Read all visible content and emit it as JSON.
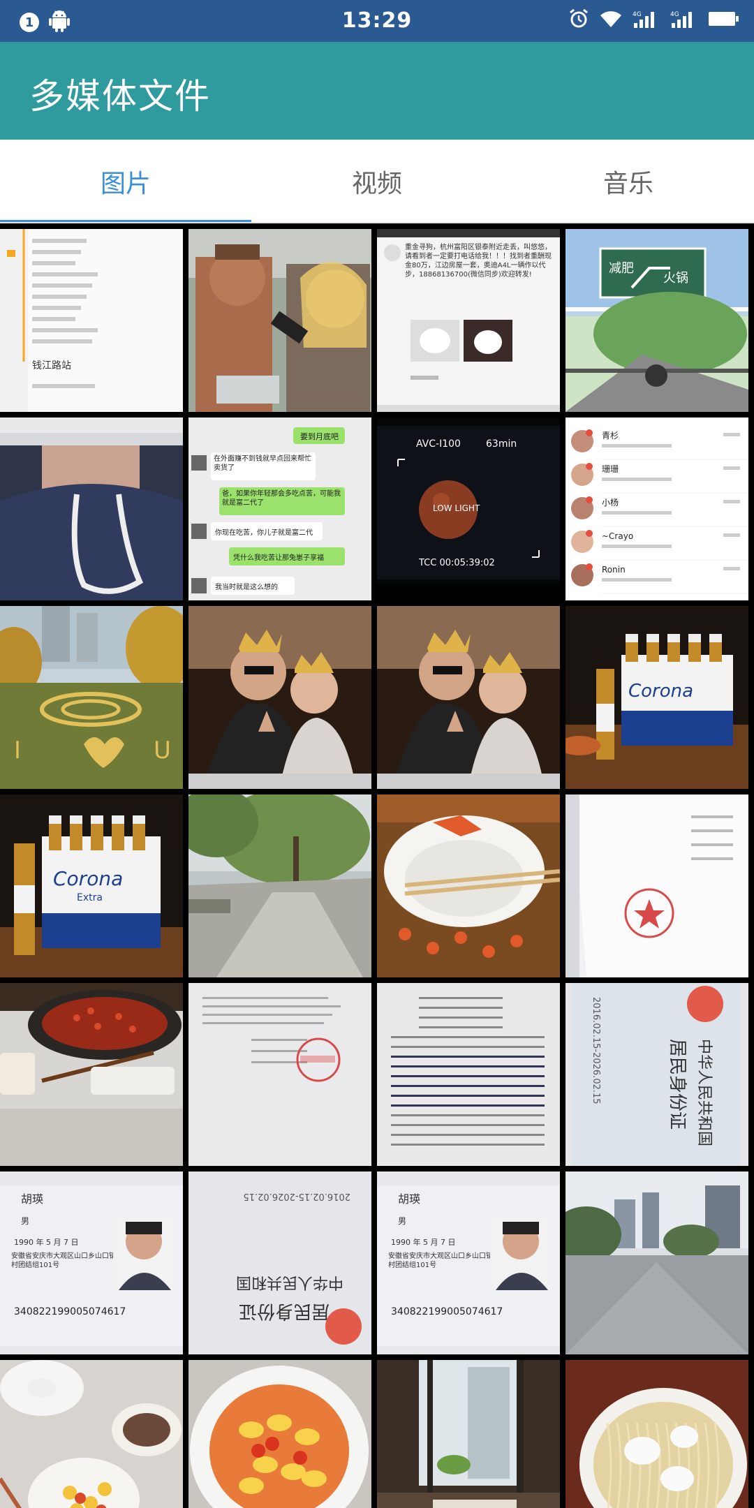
{
  "status_bar": {
    "notification_count": "1",
    "time": "13:29"
  },
  "app_bar": {
    "title": "多媒体文件"
  },
  "tabs": [
    {
      "label": "图片",
      "active": true
    },
    {
      "label": "视频",
      "active": false
    },
    {
      "label": "音乐",
      "active": false
    }
  ],
  "colors": {
    "status_bar": "#2b5a93",
    "app_bar": "#2f9b9f",
    "tab_active": "#3a8fd8",
    "tab_inactive": "#666666"
  },
  "thumbnails": [
    {
      "name": "chat-list-screenshot",
      "texts": [
        "钱江路站"
      ]
    },
    {
      "name": "interview-photo",
      "texts": []
    },
    {
      "name": "news-post-screenshot",
      "texts": [
        "重金寻狗，杭州富阳区银泰附近走丢，叫悠悠，请看到者一定要打电话给我！！！找到者重酬现金80万，江边房屋一套，奥迪A4L一辆作以代步，18868136700(微信同步)欢迎转发!"
      ]
    },
    {
      "name": "cartoon-sign-image",
      "texts": [
        "减肥",
        "火锅"
      ]
    },
    {
      "name": "hoodie-selfie",
      "texts": []
    },
    {
      "name": "chat-conversation-screenshot",
      "texts": [
        "要到月底吧",
        "在外面赚不到钱就早点回来帮忙卖货了",
        "爸，如果你年轻那会多吃点苦，可能我就是富二代了",
        "你现在吃苦，你儿子就是富二代",
        "凭什么我吃苦让那兔崽子享福",
        "我当时就是这么想的"
      ]
    },
    {
      "name": "camera-moon-screenshot",
      "texts": [
        "AVC-I100",
        "63min",
        "LOW LIGHT",
        "TCC 00:05:39:02"
      ]
    },
    {
      "name": "contact-list-screenshot",
      "texts": [
        "青杉",
        "珊珊",
        "小杨",
        "~Crayo",
        "Ronin"
      ]
    },
    {
      "name": "leaf-heart-park",
      "texts": [
        "I",
        "U"
      ]
    },
    {
      "name": "couple-crowns-photo-1",
      "texts": []
    },
    {
      "name": "couple-crowns-photo-2",
      "texts": []
    },
    {
      "name": "corona-beer-pack-1",
      "texts": [
        "Corona"
      ]
    },
    {
      "name": "corona-beer-pack-2",
      "texts": [
        "Corona",
        "Extra"
      ]
    },
    {
      "name": "tree-lined-path",
      "texts": []
    },
    {
      "name": "lobster-plate",
      "texts": []
    },
    {
      "name": "stamped-document-1",
      "texts": []
    },
    {
      "name": "hotpot-table",
      "texts": []
    },
    {
      "name": "stamped-document-2",
      "texts": []
    },
    {
      "name": "typed-document",
      "texts": []
    },
    {
      "name": "id-card-back-1",
      "texts": [
        "中华人民共和国",
        "居民身份证",
        "2016.02.15-2026.02.15"
      ]
    },
    {
      "name": "id-card-front-1",
      "texts": [
        "胡瑛",
        "男",
        "1990 年 5 月 7 日",
        "安徽省安庆市大观区山口乡山口镇村团结组101号",
        "340822199005074617"
      ]
    },
    {
      "name": "id-card-back-2",
      "texts": [
        "居民身份证",
        "中华人民共和国",
        "2016.02.15-2026.02.15"
      ]
    },
    {
      "name": "id-card-front-2",
      "texts": [
        "胡瑛",
        "男",
        "1990 年 5 月 7 日",
        "安徽省安庆市大观区山口乡山口镇村团结组101号",
        "340822199005074617"
      ]
    },
    {
      "name": "city-square-photo",
      "texts": []
    },
    {
      "name": "breakfast-table-photo",
      "texts": []
    },
    {
      "name": "tomato-egg-dish",
      "texts": []
    },
    {
      "name": "window-view-photo",
      "texts": []
    },
    {
      "name": "noodle-bowl-photo",
      "texts": []
    }
  ]
}
